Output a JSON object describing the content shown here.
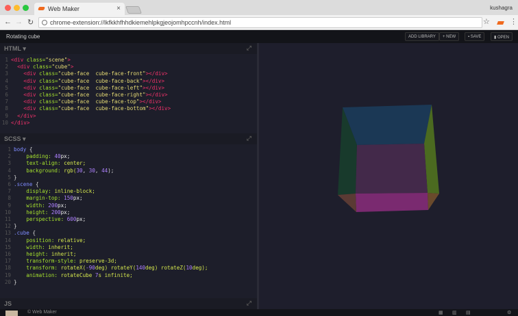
{
  "browser": {
    "tab_title": "Web Maker",
    "url": "chrome-extension://lkfkkhfhhdkiemehlpkgjeojomhpccnh/index.html",
    "user": "kushagra"
  },
  "app": {
    "title": "Rotating cube",
    "buttons": {
      "add_library": "ADD LIBRARY",
      "new": "+ NEW",
      "save": "SAVE",
      "open": "OPEN"
    }
  },
  "panes": {
    "html": "HTML ▾",
    "scss": "SCSS ▾",
    "js": "JS"
  },
  "footer": {
    "brand": "© Web Maker"
  },
  "preview": {
    "background": "#1e1e2c"
  },
  "html_code": [
    [
      [
        "<div ",
        "tag"
      ],
      [
        "class=",
        "attr"
      ],
      [
        "\"scene\"",
        "str"
      ],
      [
        ">",
        "tag"
      ]
    ],
    [
      [
        "  <div ",
        "tag"
      ],
      [
        "class=",
        "attr"
      ],
      [
        "\"cube\"",
        "str"
      ],
      [
        ">",
        "tag"
      ]
    ],
    [
      [
        "    <div ",
        "tag"
      ],
      [
        "class=",
        "attr"
      ],
      [
        "\"cube-face  cube-face-front\"",
        "str"
      ],
      [
        "></div>",
        "tag"
      ]
    ],
    [
      [
        "    <div ",
        "tag"
      ],
      [
        "class=",
        "attr"
      ],
      [
        "\"cube-face  cube-face-back\"",
        "str"
      ],
      [
        "></div>",
        "tag"
      ]
    ],
    [
      [
        "    <div ",
        "tag"
      ],
      [
        "class=",
        "attr"
      ],
      [
        "\"cube-face  cube-face-left\"",
        "str"
      ],
      [
        "></div>",
        "tag"
      ]
    ],
    [
      [
        "    <div ",
        "tag"
      ],
      [
        "class=",
        "attr"
      ],
      [
        "\"cube-face  cube-face-right\"",
        "str"
      ],
      [
        "></div>",
        "tag"
      ]
    ],
    [
      [
        "    <div ",
        "tag"
      ],
      [
        "class=",
        "attr"
      ],
      [
        "\"cube-face  cube-face-top\"",
        "str"
      ],
      [
        "></div>",
        "tag"
      ]
    ],
    [
      [
        "    <div ",
        "tag"
      ],
      [
        "class=",
        "attr"
      ],
      [
        "\"cube-face  cube-face-bottom\"",
        "str"
      ],
      [
        "></div>",
        "tag"
      ]
    ],
    [
      [
        "  </div>",
        "tag"
      ]
    ],
    [
      [
        "</div>",
        "tag"
      ]
    ]
  ],
  "scss_code": [
    [
      [
        "body ",
        "sel"
      ],
      [
        "{",
        "plain"
      ]
    ],
    [
      [
        "    padding: ",
        "prop"
      ],
      [
        "40",
        "num"
      ],
      [
        "px;",
        "unit"
      ]
    ],
    [
      [
        "    text-align: ",
        "prop"
      ],
      [
        "center;",
        "val"
      ]
    ],
    [
      [
        "    background: ",
        "prop"
      ],
      [
        "rgb(",
        "val"
      ],
      [
        "30",
        "num"
      ],
      [
        ", ",
        "plain"
      ],
      [
        "30",
        "num"
      ],
      [
        ", ",
        "plain"
      ],
      [
        "44",
        "num"
      ],
      [
        ");",
        "plain"
      ]
    ],
    [
      [
        "}",
        "plain"
      ]
    ],
    [
      [
        ".scene ",
        "sel"
      ],
      [
        "{",
        "plain"
      ]
    ],
    [
      [
        "    display: ",
        "prop"
      ],
      [
        "inline-block;",
        "val"
      ]
    ],
    [
      [
        "    margin-top: ",
        "prop"
      ],
      [
        "150",
        "num"
      ],
      [
        "px;",
        "unit"
      ]
    ],
    [
      [
        "    width: ",
        "prop"
      ],
      [
        "200",
        "num"
      ],
      [
        "px;",
        "unit"
      ]
    ],
    [
      [
        "    height: ",
        "prop"
      ],
      [
        "200",
        "num"
      ],
      [
        "px;",
        "unit"
      ]
    ],
    [
      [
        "    perspective: ",
        "prop"
      ],
      [
        "600",
        "num"
      ],
      [
        "px;",
        "unit"
      ]
    ],
    [
      [
        "}",
        "plain"
      ]
    ],
    [
      [
        ".cube ",
        "sel"
      ],
      [
        "{",
        "plain"
      ]
    ],
    [
      [
        "    position: ",
        "prop"
      ],
      [
        "relative;",
        "val"
      ]
    ],
    [
      [
        "    width: ",
        "prop"
      ],
      [
        "inherit;",
        "val"
      ]
    ],
    [
      [
        "    height: ",
        "prop"
      ],
      [
        "inherit;",
        "val"
      ]
    ],
    [
      [
        "    transform-style: ",
        "prop"
      ],
      [
        "preserve-3d;",
        "val"
      ]
    ],
    [
      [
        "    transform: ",
        "prop"
      ],
      [
        "rotateX(",
        "val"
      ],
      [
        "-90",
        "num"
      ],
      [
        "deg) rotateY(",
        "val"
      ],
      [
        "140",
        "num"
      ],
      [
        "deg) rotateZ(",
        "val"
      ],
      [
        "10",
        "num"
      ],
      [
        "deg);",
        "val"
      ]
    ],
    [
      [
        "    animation: ",
        "prop"
      ],
      [
        "rotateCube ",
        "val"
      ],
      [
        "7",
        "num"
      ],
      [
        "s infinite;",
        "val"
      ]
    ],
    [
      [
        "}",
        "plain"
      ]
    ]
  ]
}
